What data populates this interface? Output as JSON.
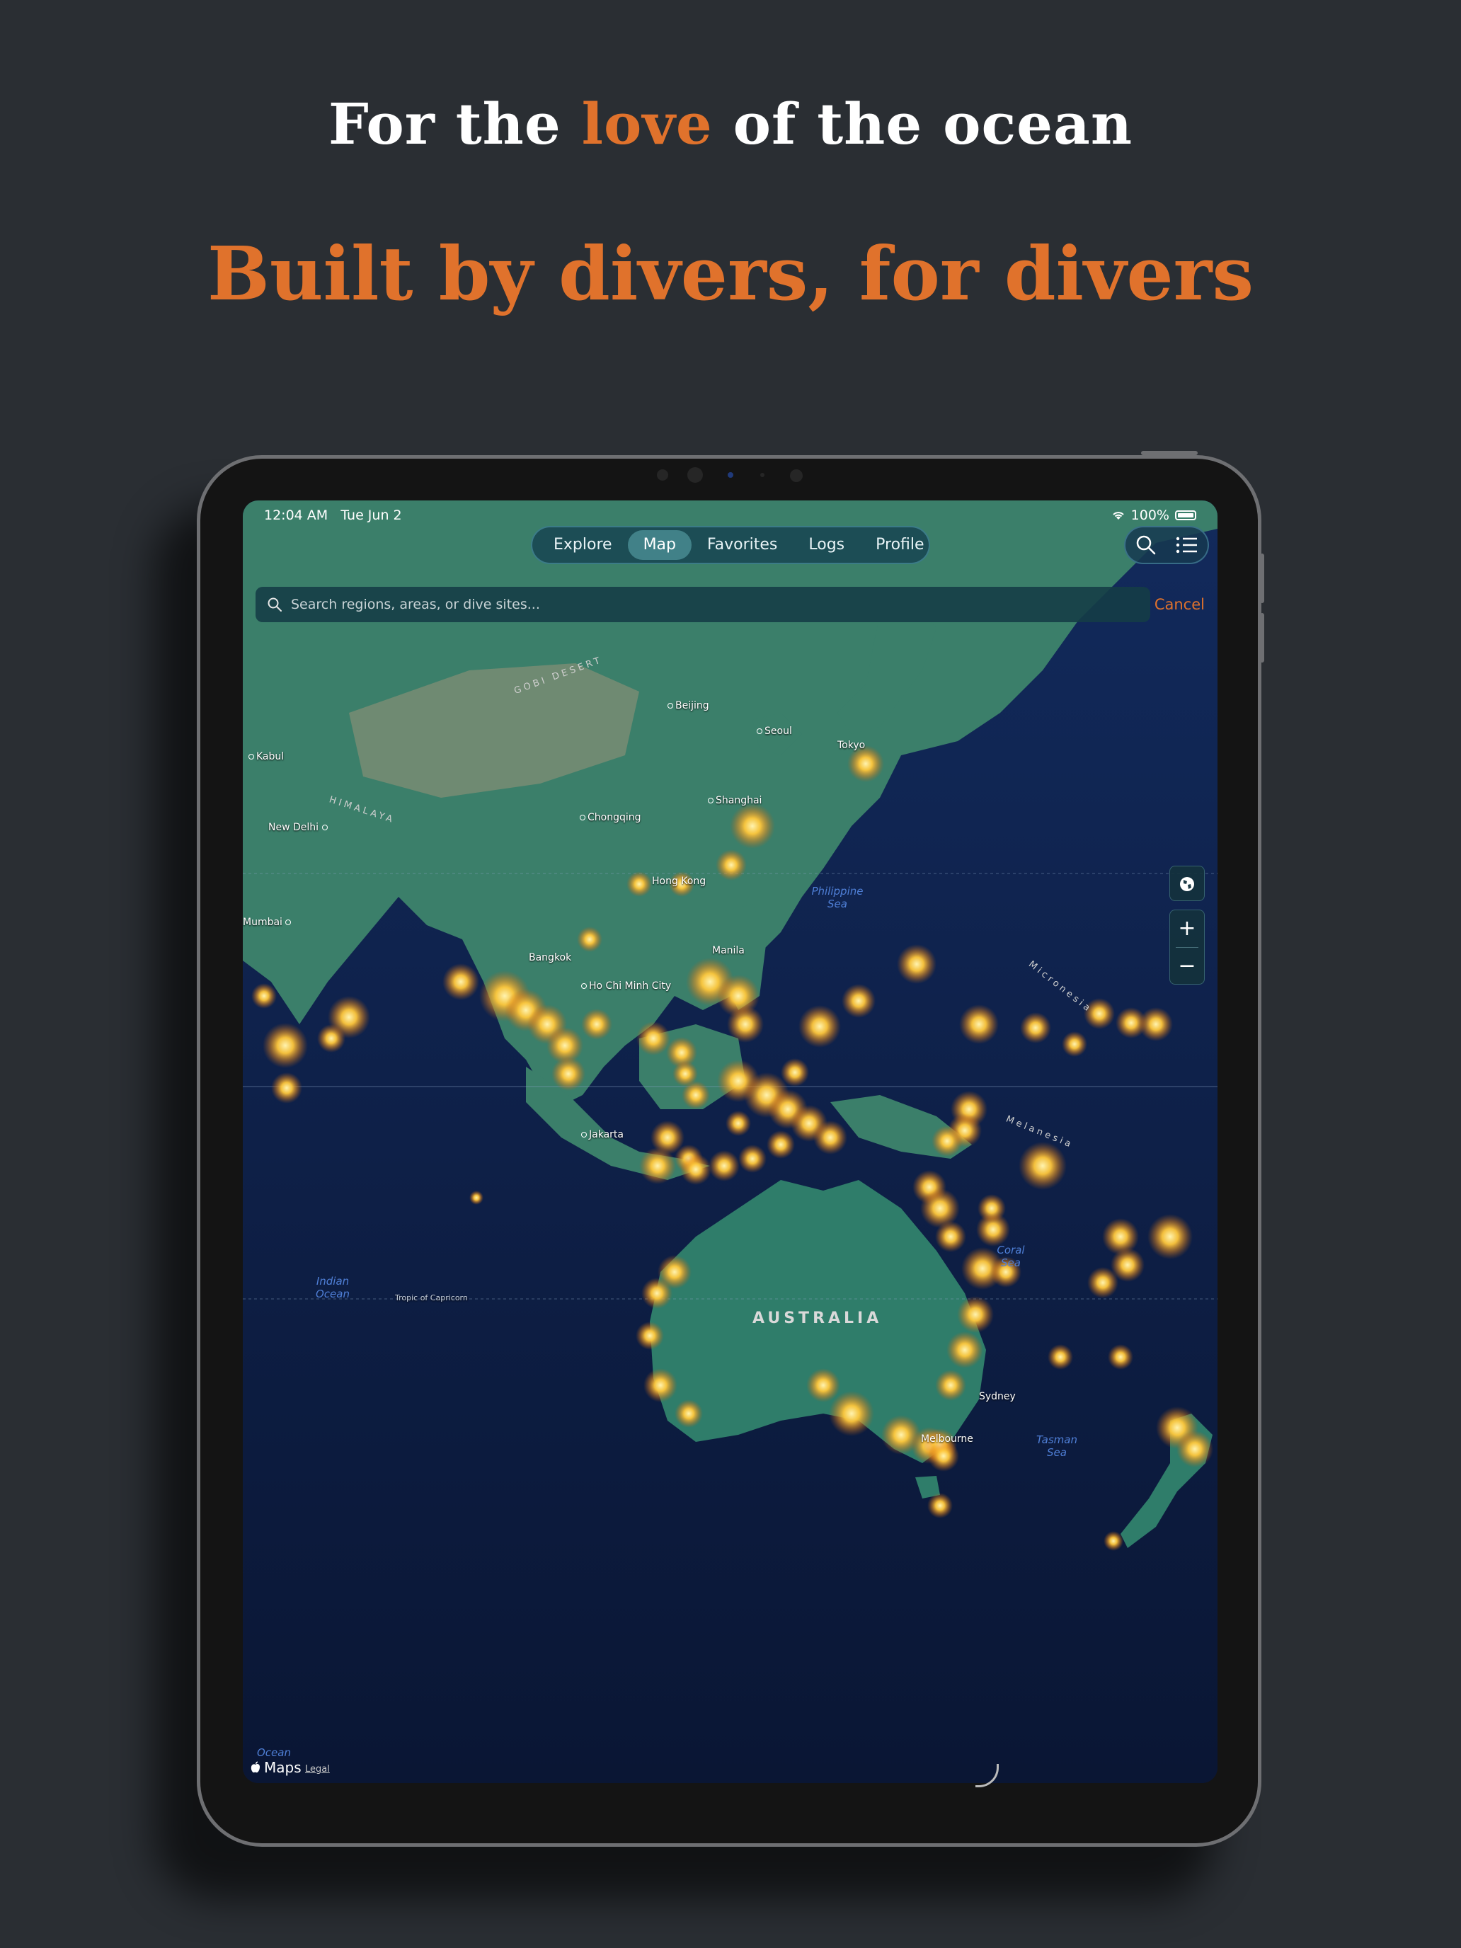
{
  "headline": {
    "line1_prefix": "For the",
    "line1_accent": "love",
    "line1_suffix": "of the ocean",
    "line2": "Built by divers, for divers"
  },
  "colors": {
    "background": "#2a2e33",
    "accent": "#e0722c",
    "ocean": "#0b1a3f",
    "land": "#2f7a6b",
    "heat": "#ffc83c"
  },
  "status_bar": {
    "time": "12:04 AM",
    "date": "Tue Jun 2",
    "battery": "100%"
  },
  "tabs": [
    {
      "label": "Explore",
      "active": false
    },
    {
      "label": "Map",
      "active": true
    },
    {
      "label": "Favorites",
      "active": false
    },
    {
      "label": "Logs",
      "active": false
    },
    {
      "label": "Profile",
      "active": false
    }
  ],
  "toolbar_icons": [
    "search-icon",
    "list-icon"
  ],
  "search": {
    "placeholder": "Search regions, areas, or dive sites...",
    "value": "",
    "cancel_label": "Cancel"
  },
  "map_controls": {
    "globe_icon": "globe-icon",
    "zoom_in": "+",
    "zoom_out": "−"
  },
  "map": {
    "cities": [
      "Beijing",
      "Seoul",
      "Tokyo",
      "Shanghai",
      "Kabul",
      "New Delhi",
      "Chongqing",
      "Hong Kong",
      "Mumbai",
      "Bangkok",
      "Manila",
      "Ho Chi Minh City",
      "Jakarta",
      "Sydney",
      "Melbourne"
    ],
    "seas": [
      "Philippine Sea",
      "Indian Ocean",
      "Coral Sea",
      "Tasman Sea",
      "Ocean"
    ],
    "regions": [
      "AUSTRALIA",
      "Micronesia",
      "Melanesia",
      "GOBI DESERT",
      "HIMALAYA"
    ],
    "lines": [
      "Tropic of Capricorn"
    ]
  },
  "attribution": {
    "brand": "Maps",
    "legal": "Legal"
  }
}
